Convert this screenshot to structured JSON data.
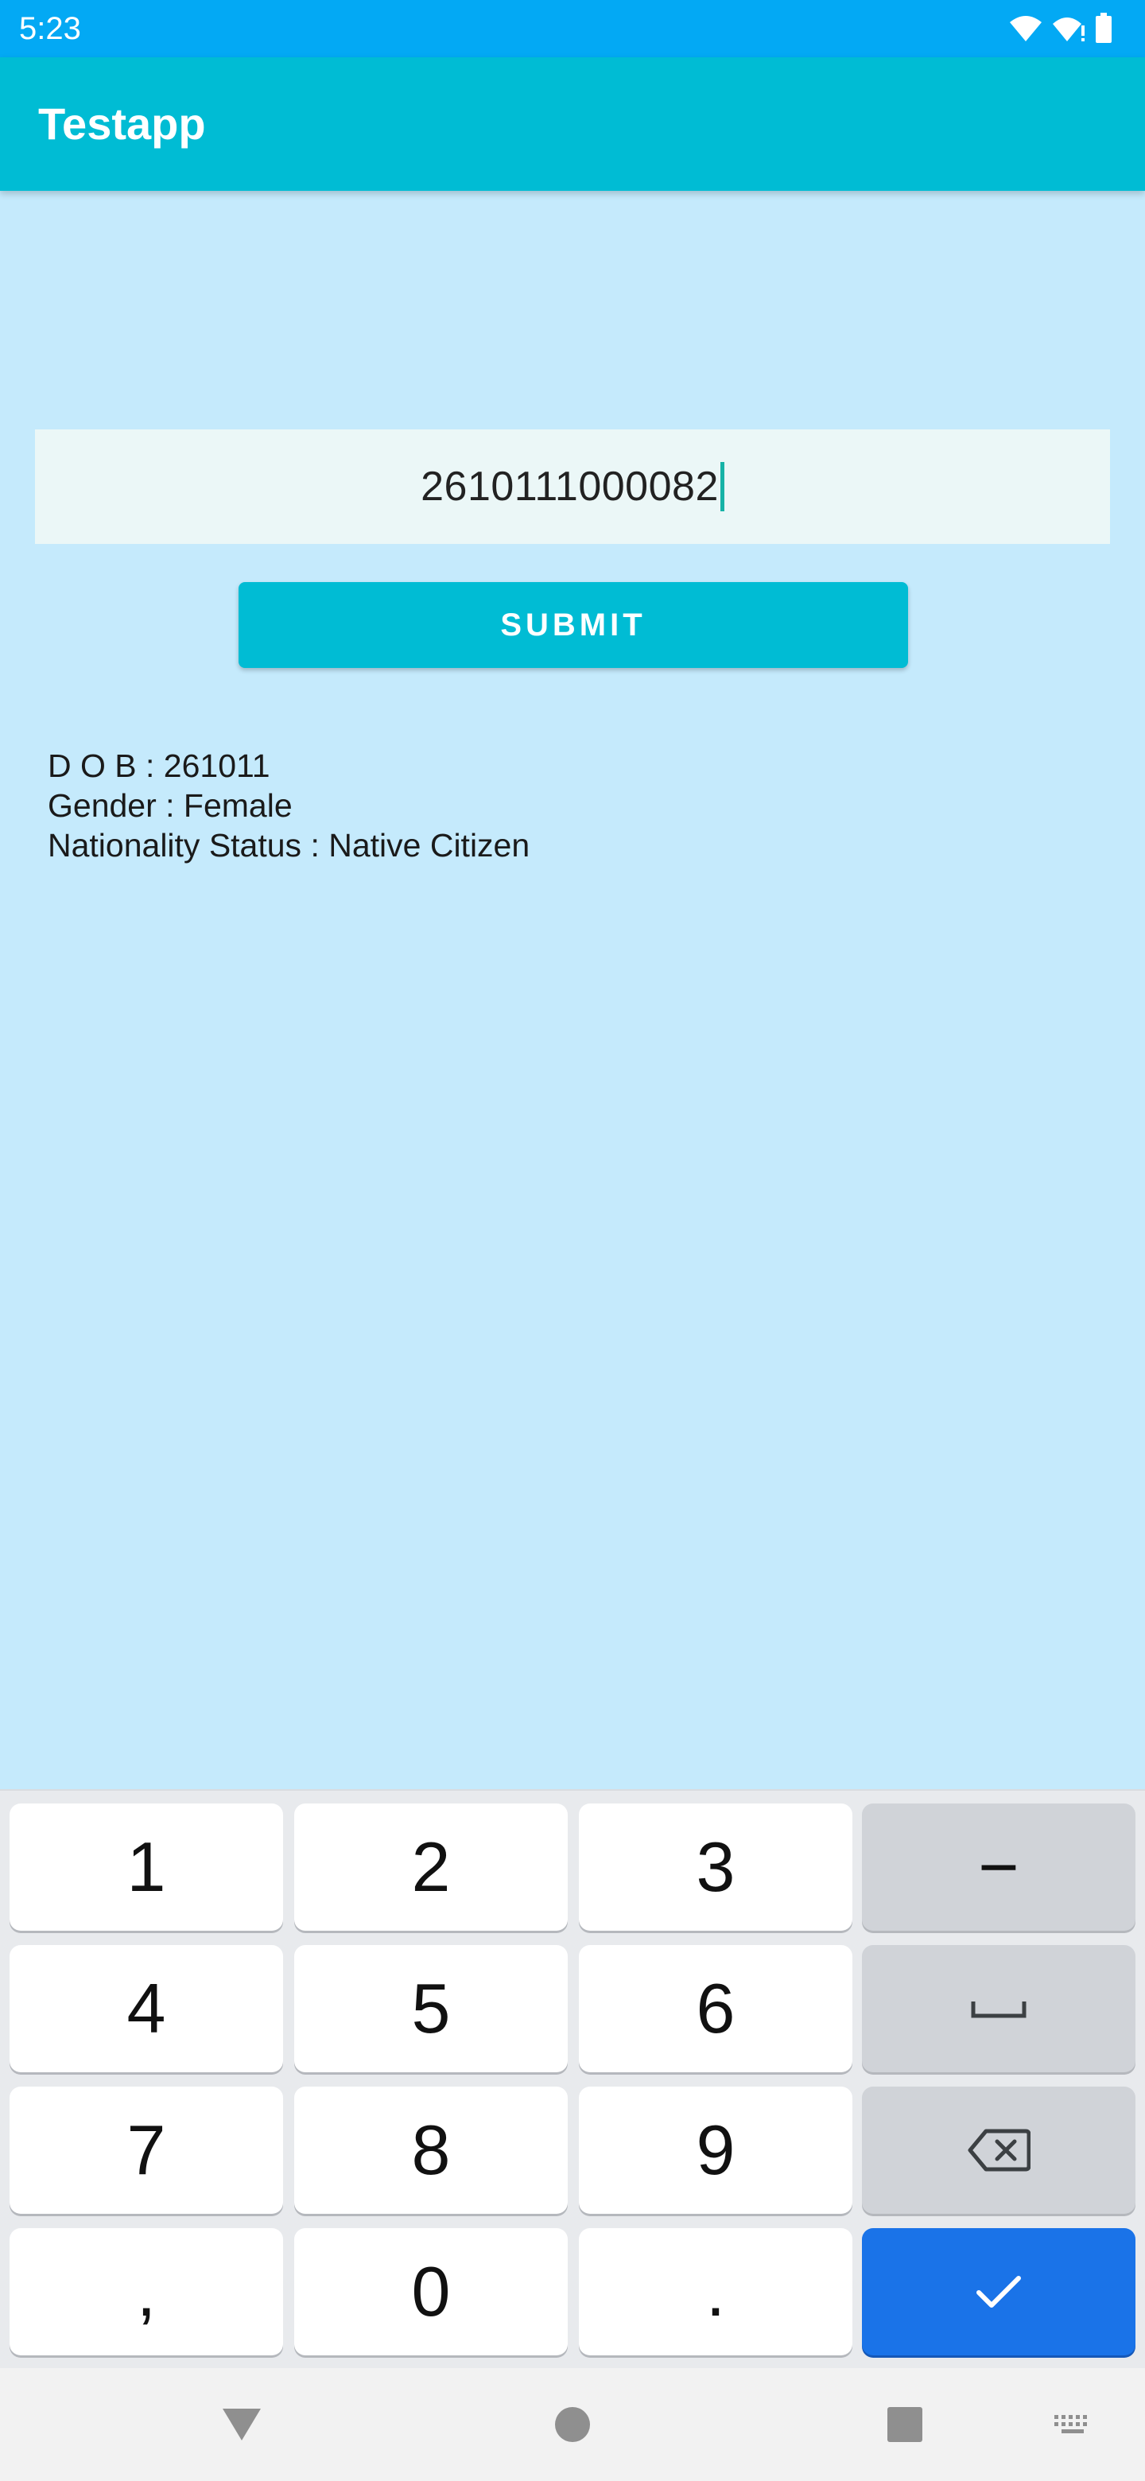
{
  "status_bar": {
    "time": "5:23",
    "icons": [
      "wifi-icon",
      "signal-icon",
      "battery-icon"
    ]
  },
  "app_bar": {
    "title": "Testapp"
  },
  "id_input": {
    "value": "2610111000082"
  },
  "submit": {
    "label": "SUBMIT"
  },
  "result": {
    "dob": "D O B : 261011",
    "gender": "Gender : Female",
    "nationality": "Nationality Status : Native Citizen"
  },
  "keyboard": {
    "keys": [
      "1",
      "2",
      "3",
      "−",
      "4",
      "5",
      "6",
      "7",
      "8",
      "9",
      ",",
      "0",
      "."
    ],
    "function_icons": [
      "space-icon",
      "backspace-icon",
      "checkmark-icon"
    ]
  },
  "nav_bar": {
    "icons": [
      "back-triangle-icon",
      "home-circle-icon",
      "recents-square-icon",
      "keyboard-switch-icon"
    ]
  },
  "colors": {
    "status_bar": "#03a9f4",
    "app_bar": "#00bcd4",
    "background": "#c5eafc",
    "input_bg": "#ebf7f7",
    "caret": "#16b3a7",
    "done_key": "#1a73e8"
  }
}
